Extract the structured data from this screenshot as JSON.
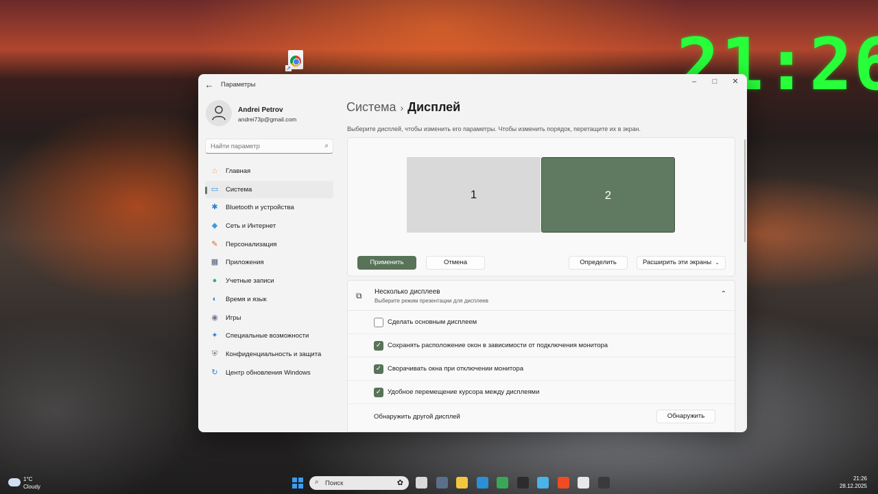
{
  "desktop": {
    "shortcut_icon": "chrome-shortcut-icon",
    "clock": "21:26"
  },
  "window": {
    "title": "Параметры",
    "controls": {
      "minimize": "–",
      "maximize": "□",
      "close": "✕"
    }
  },
  "profile": {
    "name": "Andrei Petrov",
    "email": "andrei73p@gmail.com"
  },
  "search": {
    "placeholder": "Найти параметр"
  },
  "sidebar": {
    "items": [
      {
        "label": "Главная",
        "icon": "home-icon",
        "glyph": "⌂",
        "color": "#e8a33c"
      },
      {
        "label": "Система",
        "icon": "system-icon",
        "glyph": "▭",
        "color": "#2f8ed8",
        "active": true
      },
      {
        "label": "Bluetooth и устройства",
        "icon": "bluetooth-icon",
        "glyph": "✱",
        "color": "#2a7fd4"
      },
      {
        "label": "Сеть и Интернет",
        "icon": "network-icon",
        "glyph": "◆",
        "color": "#3a9ad9"
      },
      {
        "label": "Персонализация",
        "icon": "brush-icon",
        "glyph": "✎",
        "color": "#d2691e"
      },
      {
        "label": "Приложения",
        "icon": "apps-icon",
        "glyph": "▦",
        "color": "#4a5a7a"
      },
      {
        "label": "Учетные записи",
        "icon": "accounts-icon",
        "glyph": "●",
        "color": "#2fae8a"
      },
      {
        "label": "Время и язык",
        "icon": "time-language-icon",
        "glyph": "◐",
        "color": "#2a8ec9"
      },
      {
        "label": "Игры",
        "icon": "gaming-icon",
        "glyph": "◉",
        "color": "#707a88"
      },
      {
        "label": "Специальные возможности",
        "icon": "accessibility-icon",
        "glyph": "✦",
        "color": "#2a7fd4"
      },
      {
        "label": "Конфиденциальность и защита",
        "icon": "shield-icon",
        "glyph": "⛨",
        "color": "#6f7680"
      },
      {
        "label": "Центр обновления Windows",
        "icon": "update-icon",
        "glyph": "↻",
        "color": "#2a7fd4"
      }
    ]
  },
  "main": {
    "breadcrumb_parent": "Система",
    "breadcrumb_sep": "›",
    "breadcrumb_current": "Дисплей",
    "hint": "Выберите дисплей, чтобы изменить его параметры. Чтобы изменить порядок, перетащите их в экран.",
    "monitors": [
      "1",
      "2"
    ],
    "buttons": {
      "apply": "Применить",
      "cancel": "Отмена",
      "identify": "Определить",
      "mode": "Расширить эти экраны"
    },
    "multi": {
      "title": "Несколько дисплеев",
      "subtitle": "Выберите режим презентации для дисплеев",
      "options": [
        {
          "label": "Сделать основным дисплеем",
          "checked": false
        },
        {
          "label": "Сохранять расположение окон в зависимости от подключения монитора",
          "checked": true
        },
        {
          "label": "Сворачивать окна при отключении монитора",
          "checked": true
        },
        {
          "label": "Удобное перемещение курсора между дисплеями",
          "checked": true
        }
      ],
      "detect_label": "Обнаружить другой дисплей",
      "detect_button": "Обнаружить"
    }
  },
  "taskbar": {
    "weather_temp": "1°C",
    "weather_desc": "Cloudy",
    "search_label": "Поиск",
    "time": "21:26",
    "date": "28.12.2025",
    "apps": [
      {
        "icon": "task-view-icon",
        "color": "#d9d9d9"
      },
      {
        "icon": "settings-icon",
        "color": "#5a6f8a"
      },
      {
        "icon": "file-explorer-icon",
        "color": "#f2c641"
      },
      {
        "icon": "edge-icon",
        "color": "#2b8fd6"
      },
      {
        "icon": "chrome-icon",
        "color": "#3aa757"
      },
      {
        "icon": "terminal-icon",
        "color": "#2c2c2c"
      },
      {
        "icon": "remote-desktop-icon",
        "color": "#4ab3e8"
      },
      {
        "icon": "brave-icon",
        "color": "#f04b23"
      },
      {
        "icon": "snipping-tool-icon",
        "color": "#e8e8e8"
      },
      {
        "icon": "obs-icon",
        "color": "#3a3a3a"
      }
    ]
  }
}
